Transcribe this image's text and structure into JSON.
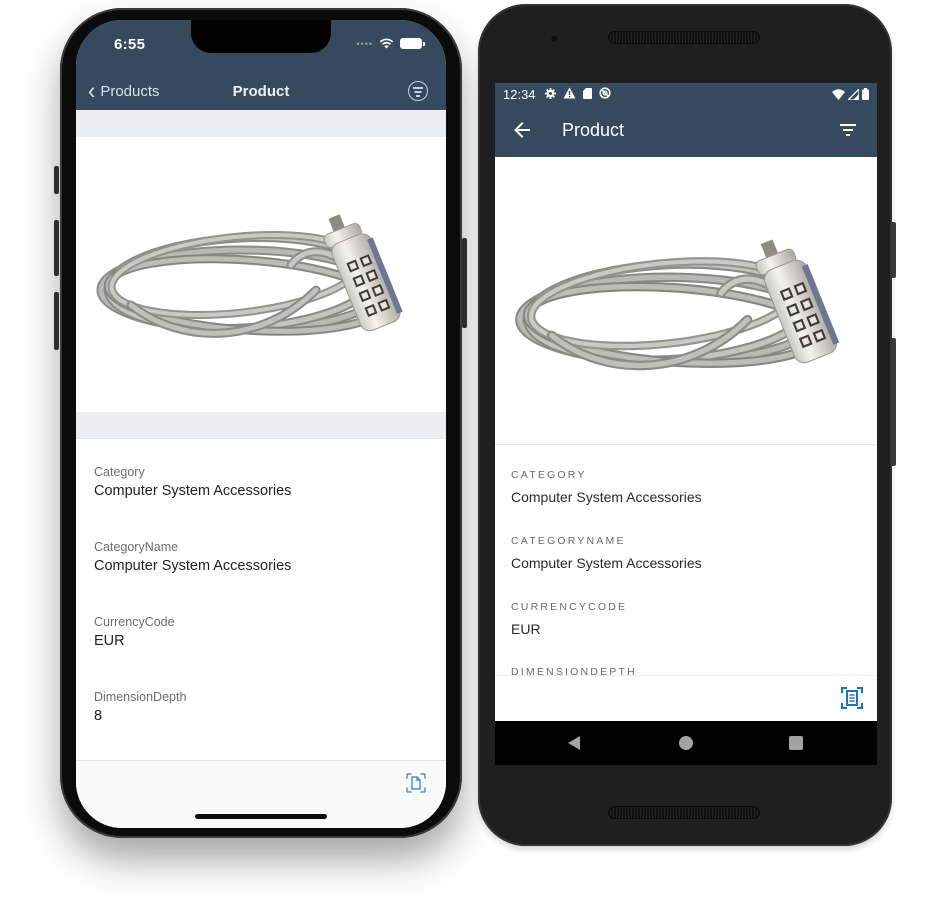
{
  "ios": {
    "status_bar": {
      "time": "6:55",
      "signal_icon": "signal-dots-icon",
      "wifi_icon": "wifi-icon",
      "battery_icon": "battery-icon"
    },
    "nav": {
      "back_label": "Products",
      "title": "Product",
      "filter_icon": "filter-circle-icon"
    },
    "product_image": {
      "alt": "Cable lock with combination barrel"
    },
    "fields": [
      {
        "label": "Category",
        "value": "Computer System Accessories"
      },
      {
        "label": "CategoryName",
        "value": "Computer System Accessories"
      },
      {
        "label": "CurrencyCode",
        "value": "EUR"
      },
      {
        "label": "DimensionDepth",
        "value": "8"
      }
    ],
    "toolbar": {
      "action_icon": "document-scan-icon"
    },
    "colors": {
      "header": "#354a5f",
      "accent": "#4a90d9"
    }
  },
  "android": {
    "status_bar": {
      "time": "12:34",
      "icons": [
        "settings-icon",
        "warning-icon",
        "sd-card-icon",
        "sync-blocked-icon"
      ],
      "right_icons": [
        "wifi-icon",
        "cell-signal-icon",
        "battery-icon"
      ]
    },
    "app_bar": {
      "title": "Product",
      "back_icon": "arrow-back-icon",
      "filter_icon": "filter-list-icon"
    },
    "product_image": {
      "alt": "Cable lock with combination barrel"
    },
    "fields": [
      {
        "label": "Category",
        "value": "Computer System Accessories"
      },
      {
        "label": "CategoryName",
        "value": "Computer System Accessories"
      },
      {
        "label": "CurrencyCode",
        "value": "EUR"
      },
      {
        "label": "DimensionDepth",
        "value": ""
      }
    ],
    "bottom_bar": {
      "action_icon": "document-scan-icon"
    },
    "nav_bar": {
      "back": "nav-back-icon",
      "home": "nav-home-icon",
      "recents": "nav-recents-icon"
    },
    "colors": {
      "header": "#354a5f",
      "accent": "#1a73c8"
    }
  }
}
